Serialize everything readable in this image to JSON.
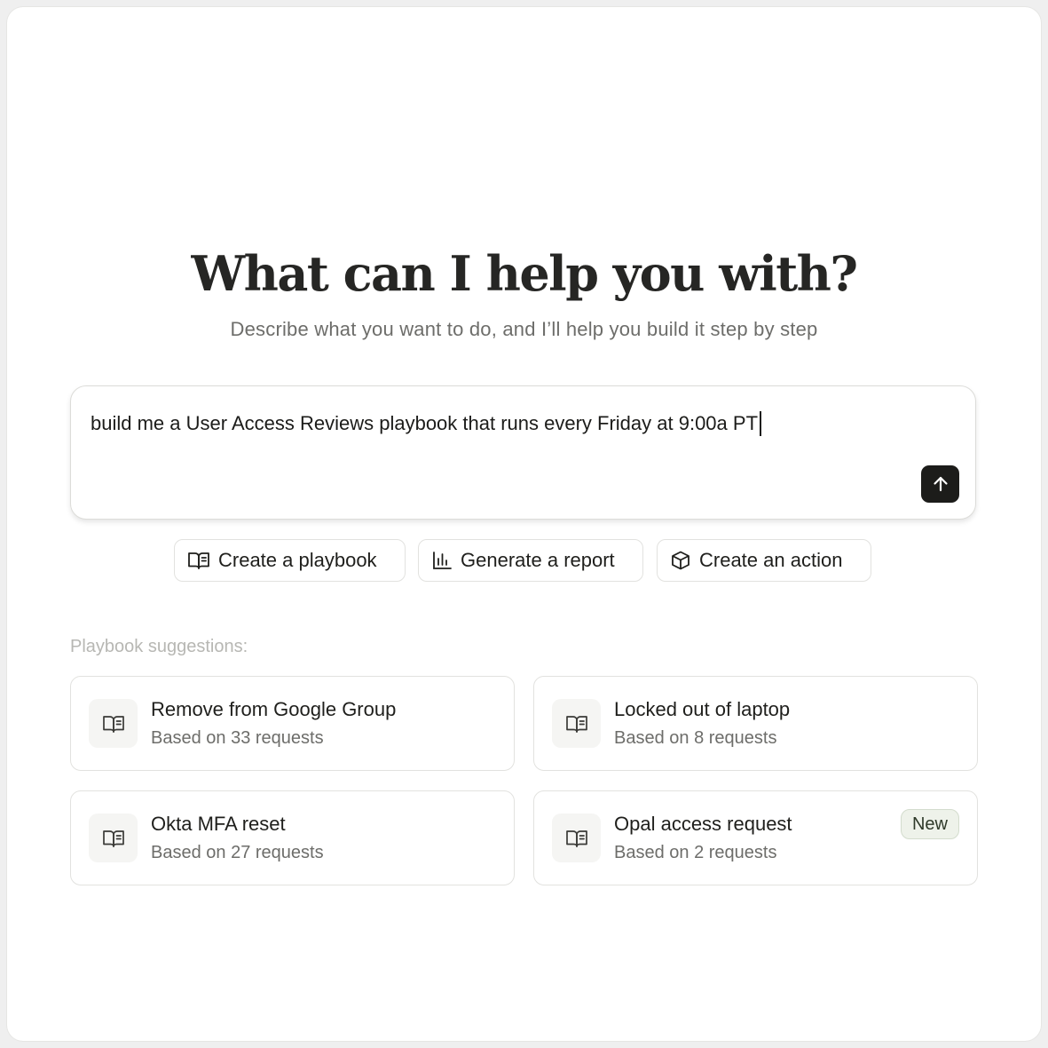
{
  "heading": {
    "title": "What can I help you with?",
    "subtitle": "Describe what you want to do, and I’ll help you build it step by step"
  },
  "prompt": {
    "value": "build me a User Access Reviews playbook that runs every Friday at 9:00a PT",
    "send_icon": "arrow-up-icon"
  },
  "actions": [
    {
      "label": "Create a playbook",
      "icon": "book-icon"
    },
    {
      "label": "Generate a report",
      "icon": "bar-chart-icon"
    },
    {
      "label": "Create an action",
      "icon": "cube-icon"
    }
  ],
  "suggestions_label": "Playbook suggestions:",
  "suggestions": [
    {
      "title": "Remove from Google Group",
      "subtitle": "Based on 33 requests",
      "icon": "book-icon"
    },
    {
      "title": "Locked out of laptop",
      "subtitle": "Based on 8 requests",
      "icon": "book-icon"
    },
    {
      "title": "Okta MFA reset",
      "subtitle": "Based on 27 requests",
      "icon": "book-icon"
    },
    {
      "title": "Opal access request",
      "subtitle": "Based on 2 requests",
      "icon": "book-icon",
      "badge": "New"
    }
  ],
  "colors": {
    "send_button": "#1c1c1a",
    "badge_bg": "#eef2ea"
  }
}
